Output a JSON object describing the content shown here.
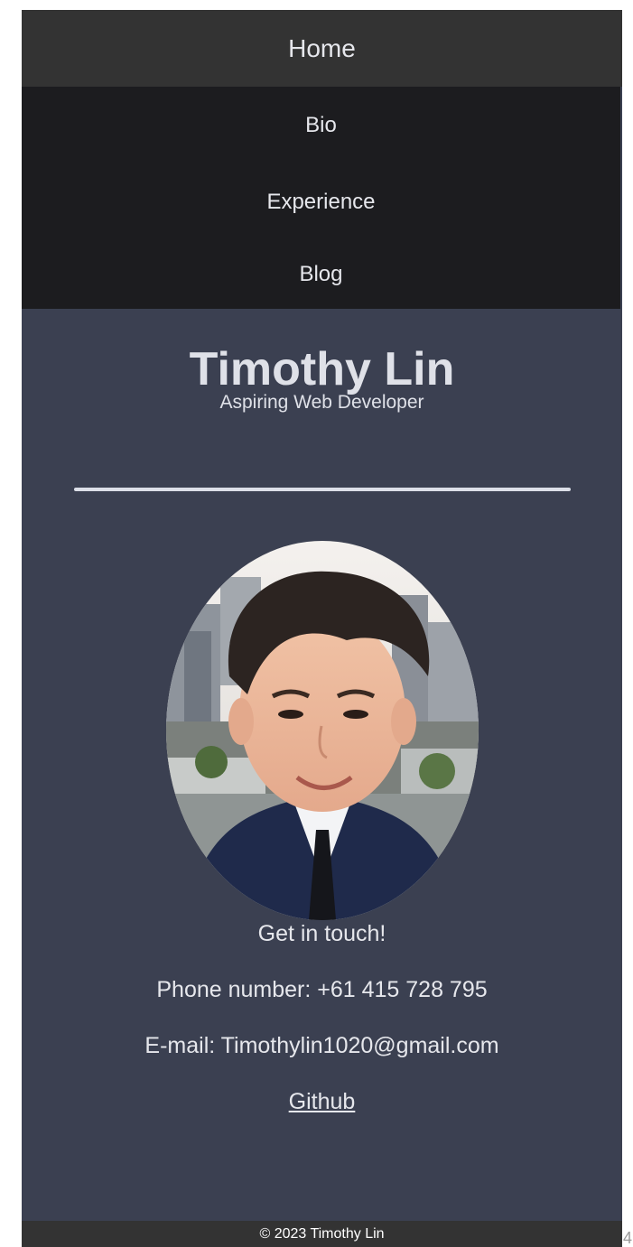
{
  "nav": {
    "home": "Home",
    "items": [
      "Bio",
      "Experience",
      "Blog"
    ]
  },
  "header": {
    "name": "Timothy Lin",
    "subtitle": "Aspiring Web Developer"
  },
  "contact": {
    "title": "Get in touch!",
    "phone": "Phone number: +61 415 728 795",
    "email": "E-mail: Timothylin1020@gmail.com",
    "github": "Github"
  },
  "footer": {
    "copyright": "© 2023 Timothy Lin"
  },
  "corner_glyph": "4",
  "colors": {
    "page_bg": "#3b4051",
    "nav_home_bg": "#333333",
    "nav_list_bg": "#1c1c1f",
    "text": "#e6e7ec"
  }
}
